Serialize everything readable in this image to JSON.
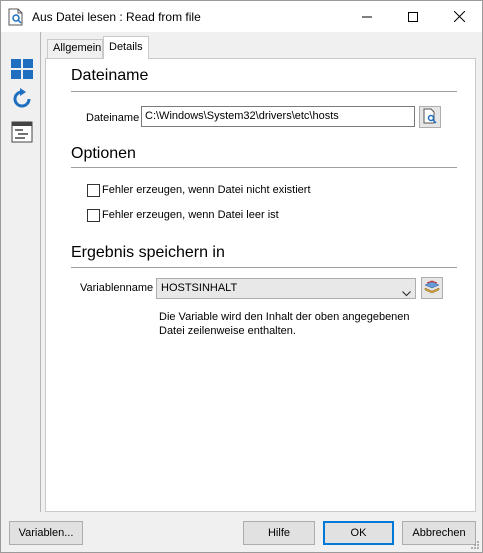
{
  "window": {
    "title": "Aus Datei lesen : Read from file"
  },
  "tabs": [
    {
      "label": "Allgemein",
      "active": false
    },
    {
      "label": "Details",
      "active": true
    }
  ],
  "sections": {
    "filename": {
      "heading": "Dateiname",
      "field_label": "Dateiname",
      "field_value": "C:\\Windows\\System32\\drivers\\etc\\hosts"
    },
    "options": {
      "heading": "Optionen",
      "checkbox_1": {
        "label": "Fehler erzeugen, wenn Datei nicht existiert",
        "checked": false
      },
      "checkbox_2": {
        "label": "Fehler erzeugen, wenn Datei leer ist",
        "checked": false
      }
    },
    "result": {
      "heading": "Ergebnis speichern in",
      "variable_label": "Variablenname",
      "variable_value": "HOSTSINHALT",
      "note": "Die Variable wird den Inhalt der oben angegebenen Datei zeilenweise enthalten."
    }
  },
  "buttons": {
    "variables": "Variablen...",
    "help": "Hilfe",
    "ok": "OK",
    "cancel": "Abbrechen"
  },
  "colors": {
    "accent": "#0078d7",
    "icon_blue": "#1e6fc0"
  }
}
